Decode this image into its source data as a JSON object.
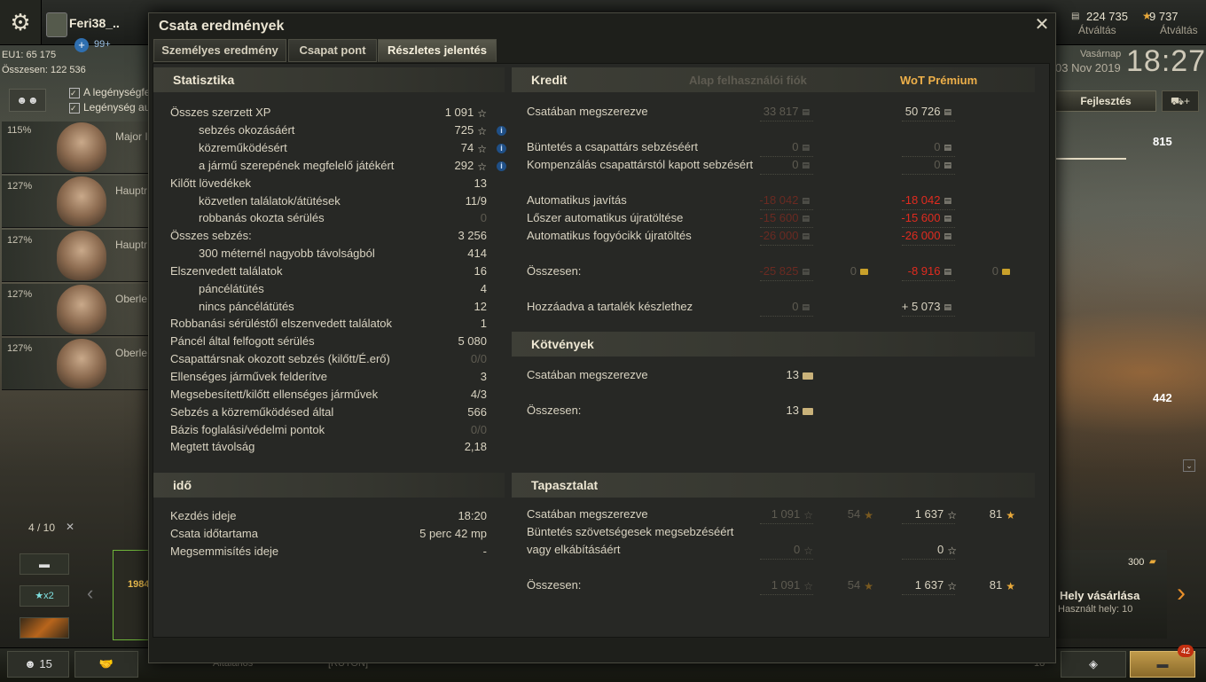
{
  "garage": {
    "player_name": "Feri38_..",
    "plus_count": "99+",
    "eu_label": "EU1: 65 175",
    "total_label": "Összesen: 122 536",
    "credits": "224 735",
    "credits_action": "Átváltás",
    "gold": "9 737",
    "gold_action": "Átváltás",
    "date_day": "Vasárnap",
    "date_date": "03 Nov 2019",
    "clock": "18:27",
    "upgrade_label": "Fejlesztés",
    "side_value_1": "815",
    "side_value_2": "442",
    "crew_check_1": "A legénységfe",
    "crew_check_2": "Legénység au",
    "crew": [
      {
        "pct": "115%",
        "name": "Major I"
      },
      {
        "pct": "127%",
        "name": "Hauptr"
      },
      {
        "pct": "127%",
        "name": "Hauptr"
      },
      {
        "pct": "127%",
        "name": "Oberle"
      },
      {
        "pct": "127%",
        "name": "Oberle"
      }
    ],
    "tank_count": "4 / 10",
    "x2_label": "★x2",
    "tank_xp": "1984",
    "buy_slot_title": "Hely vásárlása",
    "buy_slot_sub": "Használt hely: 10",
    "buy_slot_price": "300",
    "bottom_count": "15",
    "bottom_field_1": "Általános",
    "bottom_field_2": "[RUTON]",
    "bottom_num": "18",
    "notif_count": "42"
  },
  "window": {
    "title": "Csata eredmények",
    "tabs": [
      "Személyes eredmény",
      "Csapat pont",
      "Részletes jelentés"
    ],
    "active_tab": 2
  },
  "statistics": {
    "header": "Statisztika",
    "rows": [
      {
        "label": "Összes szerzett XP",
        "value": "1 091",
        "star": true,
        "info": false,
        "indent": false
      },
      {
        "label": "sebzés okozásáért",
        "value": "725",
        "star": true,
        "info": true,
        "indent": true
      },
      {
        "label": "közreműködésért",
        "value": "74",
        "star": true,
        "info": true,
        "indent": true
      },
      {
        "label": "a jármű szerepének megfelelő játékért",
        "value": "292",
        "star": true,
        "info": true,
        "indent": true
      },
      {
        "label": "Kilőtt lövedékek",
        "value": "13",
        "star": false,
        "info": false,
        "indent": false
      },
      {
        "label": "közvetlen találatok/átütések",
        "value": "11/9",
        "star": false,
        "info": false,
        "indent": true
      },
      {
        "label": "robbanás okozta sérülés",
        "value": "0",
        "star": false,
        "info": false,
        "indent": true,
        "dim": true
      },
      {
        "label": "Összes sebzés:",
        "value": "3 256",
        "star": false,
        "info": false,
        "indent": false
      },
      {
        "label": "300 méternél nagyobb távolságból",
        "value": "414",
        "star": false,
        "info": false,
        "indent": true
      },
      {
        "label": "Elszenvedett találatok",
        "value": "16",
        "star": false,
        "info": false,
        "indent": false
      },
      {
        "label": "páncélátütés",
        "value": "4",
        "star": false,
        "info": false,
        "indent": true
      },
      {
        "label": "nincs páncélátütés",
        "value": "12",
        "star": false,
        "info": false,
        "indent": true
      },
      {
        "label": "Robbanási sérüléstől elszenvedett találatok",
        "value": "1",
        "star": false,
        "info": false,
        "indent": false
      },
      {
        "label": "Páncél által felfogott sérülés",
        "value": "5 080",
        "star": false,
        "info": false,
        "indent": false
      },
      {
        "label": "Csapattársnak okozott sebzés (kilőtt/É.erő)",
        "value": "0/0",
        "star": false,
        "info": false,
        "indent": false,
        "dim": true
      },
      {
        "label": "Ellenséges járművek felderítve",
        "value": "3",
        "star": false,
        "info": false,
        "indent": false
      },
      {
        "label": "Megsebesített/kilőtt ellenséges járművek",
        "value": "4/3",
        "star": false,
        "info": false,
        "indent": false
      },
      {
        "label": "Sebzés a közreműködésed által",
        "value": "566",
        "star": false,
        "info": false,
        "indent": false
      },
      {
        "label": "Bázis foglalási/védelmi pontok",
        "value": "0/0",
        "star": false,
        "info": false,
        "indent": false,
        "dim": true
      },
      {
        "label": "Megtett távolság",
        "value": "2,18",
        "star": false,
        "info": false,
        "indent": false
      }
    ]
  },
  "time": {
    "header": "idő",
    "rows": [
      {
        "label": "Kezdés ideje",
        "value": "18:20"
      },
      {
        "label": "Csata időtartama",
        "value": "5 perc 42 mp"
      },
      {
        "label": "Megsemmisítés ideje",
        "value": "-"
      }
    ]
  },
  "credits": {
    "header": "Kredit",
    "col_base": "Alap felhasználói fiók",
    "col_premium": "WoT Prémium",
    "rows": [
      {
        "label": "Csatában megszerezve",
        "base": "33 817",
        "base_style": "dim",
        "prem": "50 726",
        "prem_style": "normal",
        "base_gold": "",
        "prem_gold": ""
      },
      {
        "label": "Büntetés a csapattárs sebzéséért",
        "base": "0",
        "base_style": "dim",
        "prem": "0",
        "prem_style": "dim",
        "base_gold": "",
        "prem_gold": ""
      },
      {
        "label": "Kompenzálás csapattárstól kapott sebzésért",
        "base": "0",
        "base_style": "dim",
        "prem": "0",
        "prem_style": "dim",
        "base_gold": "",
        "prem_gold": ""
      },
      {
        "label": "Automatikus javítás",
        "base": "-18 042",
        "base_style": "reddim",
        "prem": "-18 042",
        "prem_style": "red",
        "base_gold": "",
        "prem_gold": ""
      },
      {
        "label": "Lőszer automatikus újratöltése",
        "base": "-15 600",
        "base_style": "reddim",
        "prem": "-15 600",
        "prem_style": "red",
        "base_gold": "",
        "prem_gold": ""
      },
      {
        "label": "Automatikus fogyócikk újratöltés",
        "base": "-26 000",
        "base_style": "reddim",
        "prem": "-26 000",
        "prem_style": "red",
        "base_gold": "",
        "prem_gold": ""
      },
      {
        "label": "Összesen:",
        "base": "-25 825",
        "base_style": "reddim",
        "prem": "-8 916",
        "prem_style": "red",
        "base_gold": "0",
        "prem_gold": "0"
      },
      {
        "label": "Hozzáadva a tartalék készlethez",
        "base": "0",
        "base_style": "dim",
        "prem": "+ 5 073",
        "prem_style": "normal",
        "base_gold": "",
        "prem_gold": ""
      }
    ]
  },
  "bonds": {
    "header": "Kötvények",
    "rows": [
      {
        "label": "Csatában megszerezve",
        "value": "13"
      },
      {
        "label": "Összesen:",
        "value": "13"
      }
    ]
  },
  "experience": {
    "header": "Tapasztalat",
    "rows": [
      {
        "label": "Csatában megszerezve",
        "label2": "",
        "base_xp": "1 091",
        "base_fxp": "54",
        "prem_xp": "1 637",
        "prem_fxp": "81"
      },
      {
        "label": "Büntetés szövetségesek megsebzéséért",
        "label2": "vagy elkábításáért",
        "base_xp": "0",
        "base_fxp": "",
        "prem_xp": "0",
        "prem_fxp": ""
      },
      {
        "label": "Összesen:",
        "label2": "",
        "base_xp": "1 091",
        "base_fxp": "54",
        "prem_xp": "1 637",
        "prem_fxp": "81"
      }
    ]
  },
  "colors": {
    "negative": "#e02b1f",
    "premium": "#eeb04a",
    "dim": "#5e5b51"
  }
}
